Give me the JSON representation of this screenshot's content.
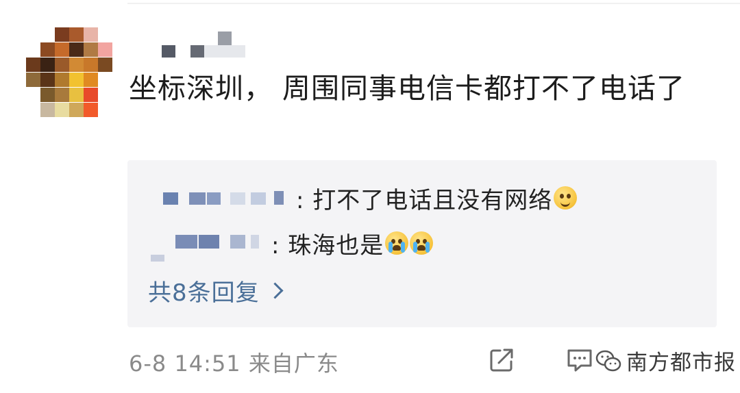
{
  "comment": {
    "text": "坐标深圳， 周围同事电信卡都打不了电话了",
    "meta": "6-8 14:51 来自广东"
  },
  "replies": [
    {
      "text": ": 打不了电话且没有网络",
      "emoji": "grimace-emoji-icon"
    },
    {
      "text": ": 珠海也是",
      "emoji": "crying-emoji-icon"
    }
  ],
  "reply_count_label": "共8条回复",
  "watermark": {
    "name": "南方都市报"
  },
  "colors": {
    "link": "#4a6f98",
    "reply_bg": "#f4f4f6",
    "meta_text": "#8a8a8a"
  },
  "icons": [
    "share-icon",
    "comment-icon",
    "chevron-right-icon",
    "wechat-logo-icon"
  ]
}
